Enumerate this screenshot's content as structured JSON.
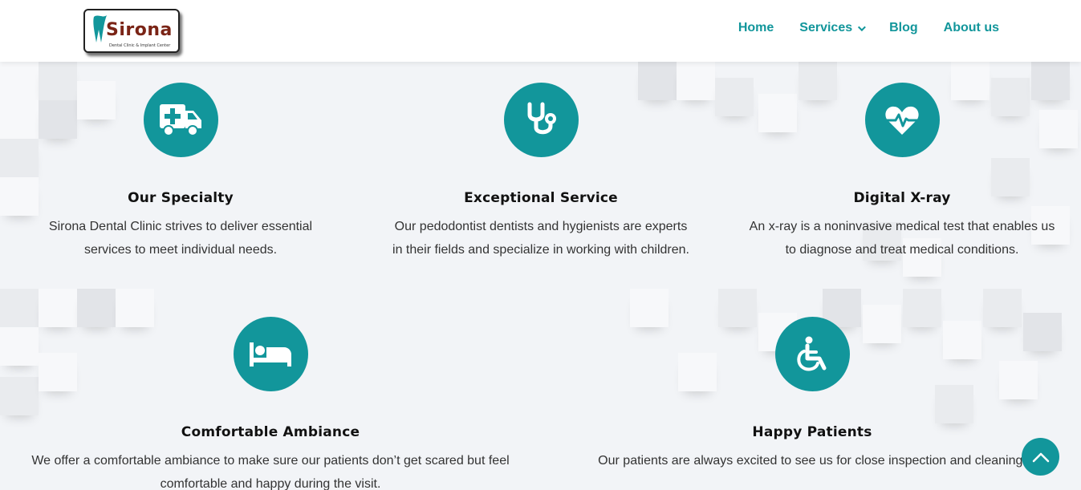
{
  "header": {
    "logo": {
      "name": "Sirona",
      "tagline": "Dental Clinic & Implant Center"
    },
    "nav": [
      {
        "label": "Home"
      },
      {
        "label": "Services"
      },
      {
        "label": "Blog"
      },
      {
        "label": "About us"
      }
    ]
  },
  "features": [
    {
      "icon": "ambulance-icon",
      "title": "Our Specialty",
      "line1": "Sirona Dental Clinic strives to deliver essential",
      "line2": "services to meet individual needs."
    },
    {
      "icon": "stethoscope-icon",
      "title": "Exceptional Service",
      "line1": "Our pedodontist dentists and hygienists are experts",
      "line2": "in their fields and specialize in working with children."
    },
    {
      "icon": "heartbeat-icon",
      "title": "Digital X-ray",
      "line1": "An x-ray is a noninvasive medical test that enables us",
      "line2": "to diagnose and treat medical conditions."
    },
    {
      "icon": "bed-icon",
      "title": "Comfortable Ambiance",
      "line1": "We offer a comfortable ambiance to make sure our patients don’t get scared but feel",
      "line2": "comfortable and happy during the visit."
    },
    {
      "icon": "wheelchair-icon",
      "title": "Happy Patients",
      "line1": "Our patients are always excited to see us for close inspection and cleaning.",
      "line2": ""
    }
  ],
  "colors": {
    "accent": "#12969b",
    "brand": "#7a2416",
    "background": "#f2f4f7"
  },
  "scroll_top": {
    "icon": "chevron-up-icon"
  }
}
